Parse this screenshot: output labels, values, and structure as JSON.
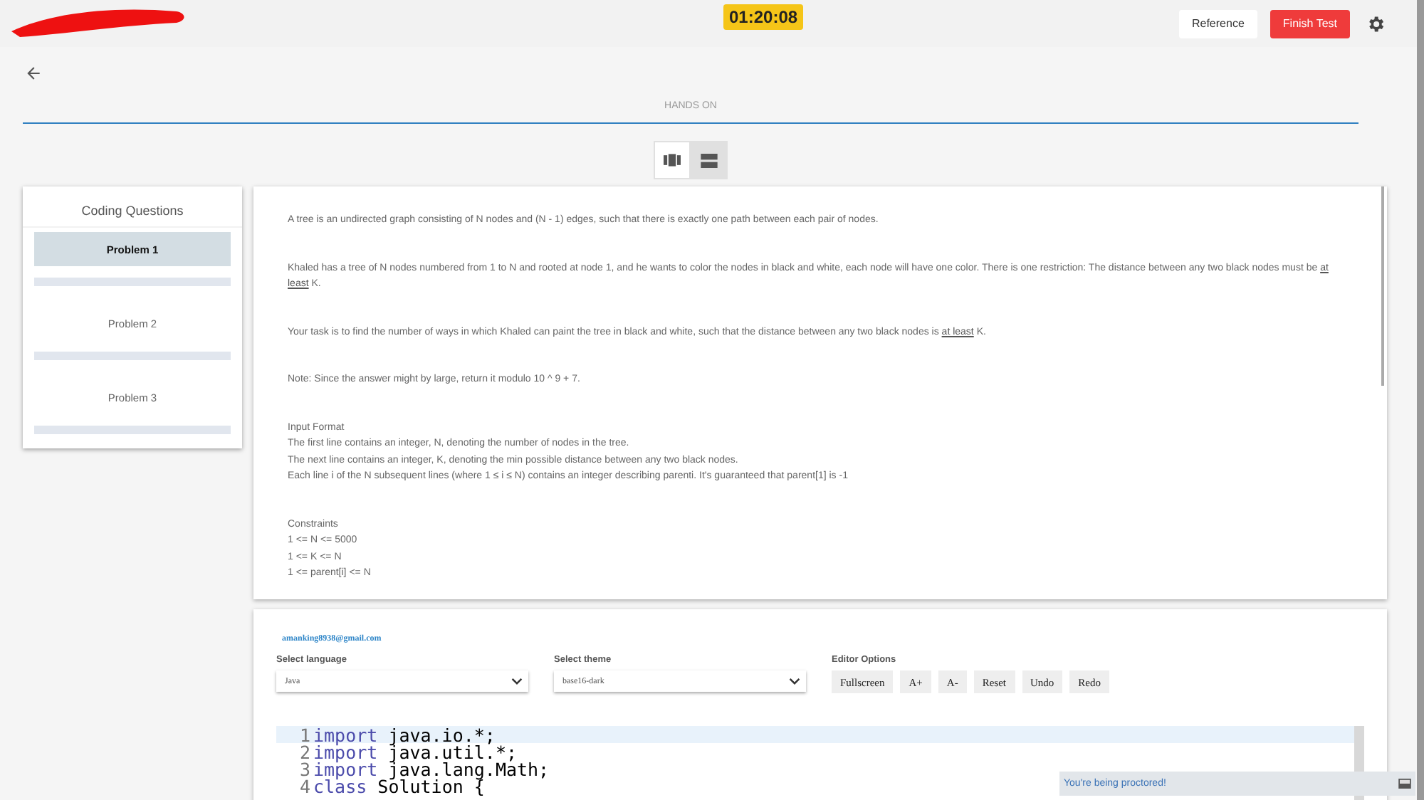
{
  "header": {
    "timer": "01:20:08",
    "buttons": [
      {
        "label": "Reference",
        "kind": "plain"
      },
      {
        "label": "Finish Test",
        "kind": "danger"
      }
    ]
  },
  "section_title": "HANDS ON",
  "view_toggle": [
    {
      "selected": false
    },
    {
      "selected": true
    }
  ],
  "sidebar": {
    "title": "Coding Questions",
    "items": [
      {
        "label": "Problem 1",
        "selected": true,
        "level": 0
      },
      {
        "label": "Problem 2",
        "selected": false,
        "level": 0
      },
      {
        "label": "Problem 3",
        "selected": false,
        "level": 0
      }
    ]
  },
  "problem": {
    "paragraphs": [
      [
        "A tree is an undirected graph consisting of N nodes and (N - 1) edges, such that there is exactly one path between each pair of nodes."
      ],
      [
        [
          {
            "text": "Khaled has a tree of N nodes numbered from 1 to N and rooted at node 1, and he wants to color the nodes in black and white, each node will have one color. There is one restriction: The distance between any two black nodes must be ",
            "underline": false
          },
          {
            "text": "at least",
            "underline": true
          },
          {
            "text": " K.",
            "underline": false
          }
        ]
      ],
      [
        [
          {
            "text": "Your task is to find the number of ways in which Khaled can paint the tree in black and white, such that the distance between any two black nodes is ",
            "underline": false
          },
          {
            "text": "at least",
            "underline": true
          },
          {
            "text": " K.",
            "underline": false
          }
        ]
      ],
      [
        "Note: Since the answer might by large, return it modulo 10 ^ 9 + 7."
      ],
      [
        "Input Format",
        "The first line contains an integer, N, denoting the number of nodes in the tree.",
        "The next line contains an integer, K, denoting the min possible distance between any two black nodes.",
        "Each line i of the N subsequent lines (where 1 ≤ i ≤ N) contains an integer describing parenti. It's guaranteed that parent[1] is -1"
      ],
      [
        "Constraints",
        "1 <= N <= 5000",
        "1 <= K <= N",
        "1 <= parent[i] <= N"
      ]
    ]
  },
  "editor": {
    "user": "amanking8938@gmail.com",
    "language": {
      "label": "Select language",
      "value": "Java"
    },
    "theme": {
      "label": "Select theme",
      "value": "base16-dark"
    },
    "options": {
      "label": "Editor Options",
      "buttons": [
        "Fullscreen",
        "A+",
        "A-",
        "Reset",
        "Undo",
        "Redo"
      ]
    },
    "lines": [
      {
        "number": "1",
        "keyword": "import",
        "rest": " java.io.*;",
        "current": true
      },
      {
        "number": "2",
        "keyword": "import",
        "rest": " java.util.*;",
        "current": false
      },
      {
        "number": "3",
        "keyword": "import",
        "rest": " java.lang.Math;",
        "current": false
      },
      {
        "number": "4",
        "keyword": "class",
        "rest": " Solution {",
        "current": false
      }
    ]
  },
  "toast": "You're being proctored!"
}
